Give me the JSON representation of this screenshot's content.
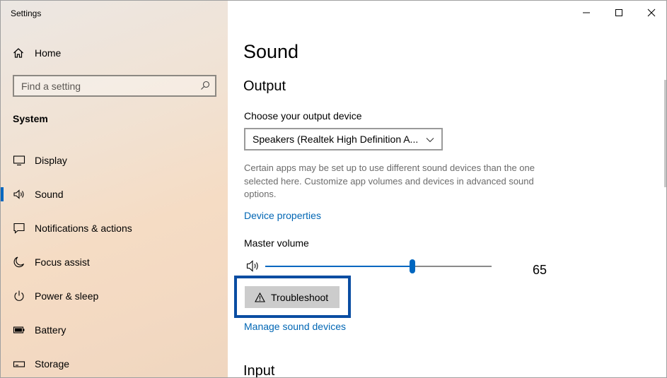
{
  "window": {
    "app_title": "Settings",
    "controls": [
      "minimize-icon",
      "maximize-icon",
      "close-icon"
    ]
  },
  "sidebar": {
    "home_label": "Home",
    "search_placeholder": "Find a setting",
    "section": "System",
    "items": [
      {
        "label": "Display",
        "icon": "display-icon",
        "selected": false
      },
      {
        "label": "Sound",
        "icon": "speaker-icon",
        "selected": true
      },
      {
        "label": "Notifications & actions",
        "icon": "notifications-icon",
        "selected": false
      },
      {
        "label": "Focus assist",
        "icon": "moon-icon",
        "selected": false
      },
      {
        "label": "Power & sleep",
        "icon": "power-icon",
        "selected": false
      },
      {
        "label": "Battery",
        "icon": "battery-icon",
        "selected": false
      },
      {
        "label": "Storage",
        "icon": "storage-icon",
        "selected": false
      }
    ]
  },
  "main": {
    "title": "Sound",
    "output_heading": "Output",
    "choose_device_label": "Choose your output device",
    "output_device": "Speakers (Realtek High Definition A...",
    "description": "Certain apps may be set up to use different sound devices than the one selected here. Customize app volumes and devices in advanced sound options.",
    "device_properties_link": "Device properties",
    "master_volume_label": "Master volume",
    "volume_value": "65",
    "volume_level": 0.65,
    "troubleshoot_label": "Troubleshoot",
    "manage_devices_link": "Manage sound devices",
    "input_heading": "Input"
  },
  "colors": {
    "accent": "#0067c0",
    "link": "#0066b4",
    "highlight_border": "#0a4da2"
  }
}
